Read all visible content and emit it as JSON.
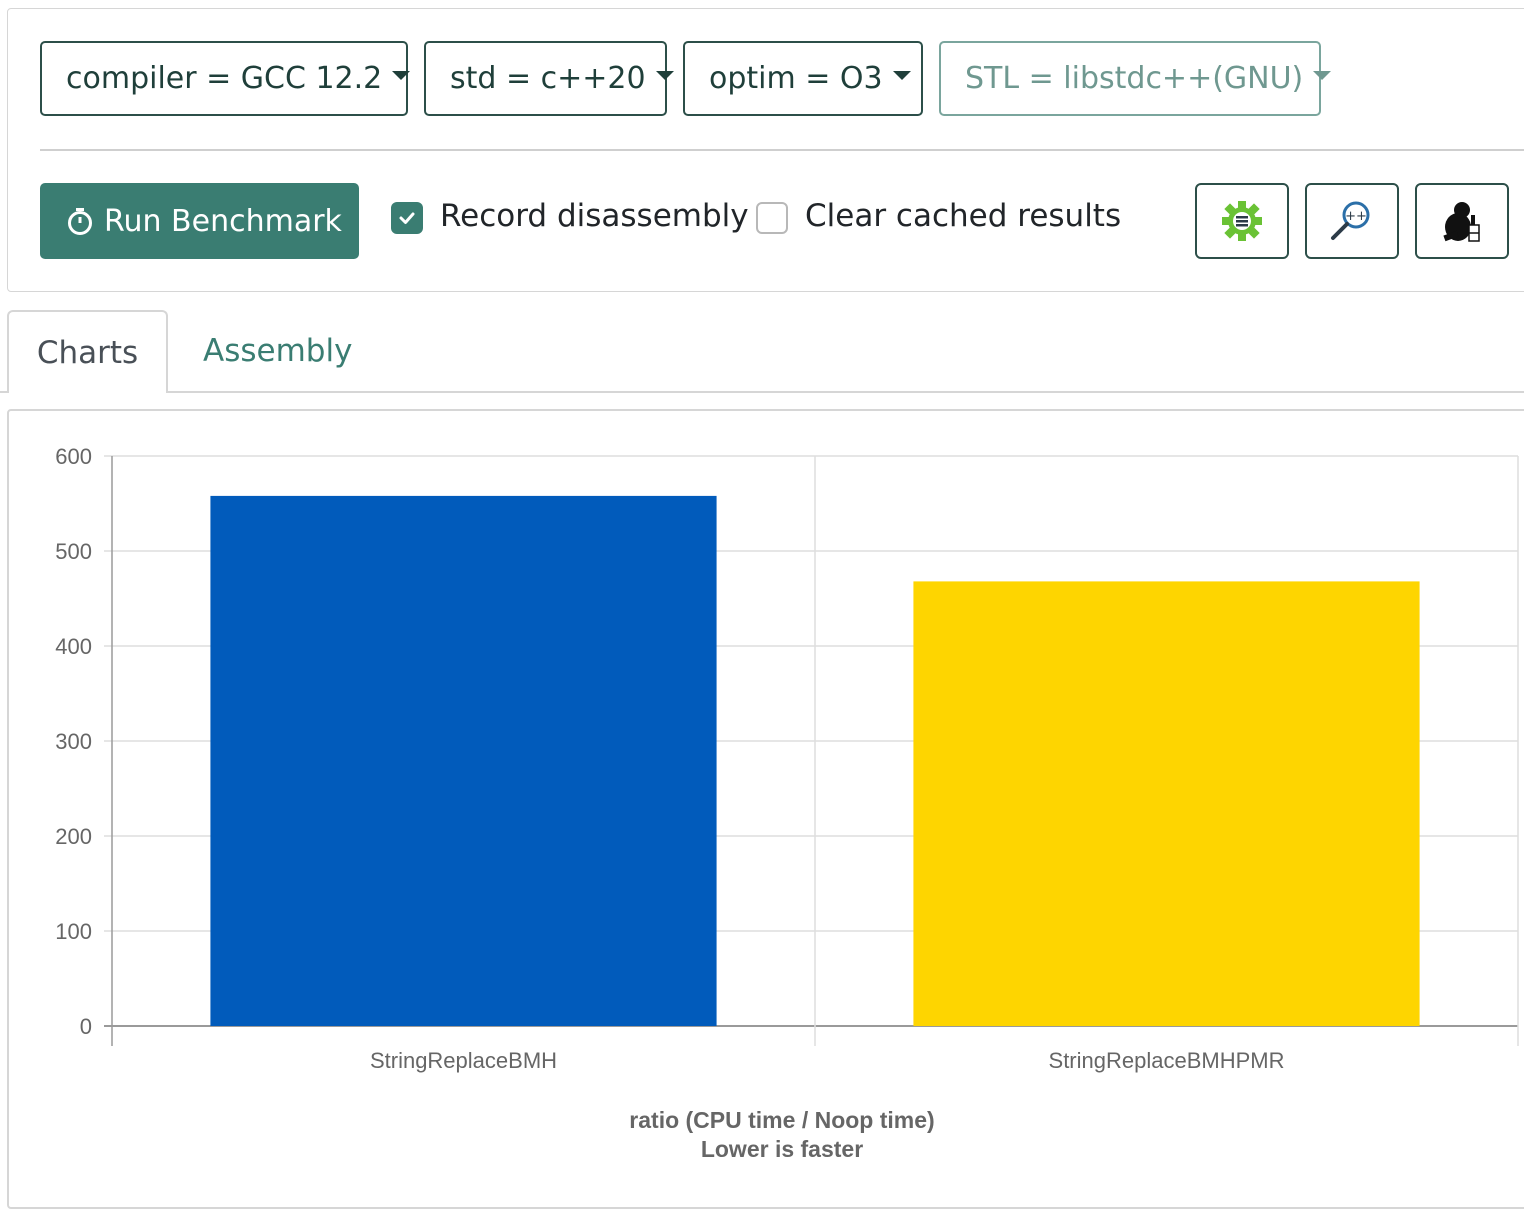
{
  "dropdowns": [
    {
      "label": "compiler = GCC 12.2",
      "disabled": false
    },
    {
      "label": "std = c++20",
      "disabled": false
    },
    {
      "label": "optim = O3",
      "disabled": false
    },
    {
      "label": "STL = libstdc++(GNU)",
      "disabled": true
    }
  ],
  "actions": {
    "run_label": "Run Benchmark",
    "record_disassembly": {
      "label": "Record disassembly",
      "checked": true
    },
    "clear_cache": {
      "label": "Clear cached results",
      "checked": false
    }
  },
  "tools": [
    {
      "icon": "cpp-settings-icon"
    },
    {
      "icon": "cpp-search-icon"
    },
    {
      "icon": "beaver-icon"
    }
  ],
  "tabs": {
    "active": "Charts",
    "other": "Assembly"
  },
  "colors": {
    "accent": "#3a7d72",
    "border_dark": "#2c4f49",
    "series_blue": "#015bbb",
    "series_yellow": "#fed500"
  },
  "chart_data": {
    "type": "bar",
    "categories": [
      "StringReplaceBMH",
      "StringReplaceBMHPMR"
    ],
    "values": [
      558,
      468
    ],
    "bar_colors": [
      "#015bbb",
      "#fed500"
    ],
    "ylim": [
      0,
      600
    ],
    "yticks": [
      0,
      100,
      200,
      300,
      400,
      500,
      600
    ],
    "xlabel": "ratio (CPU time / Noop time)",
    "xlabel_sub": "Lower is faster",
    "grid": true
  }
}
